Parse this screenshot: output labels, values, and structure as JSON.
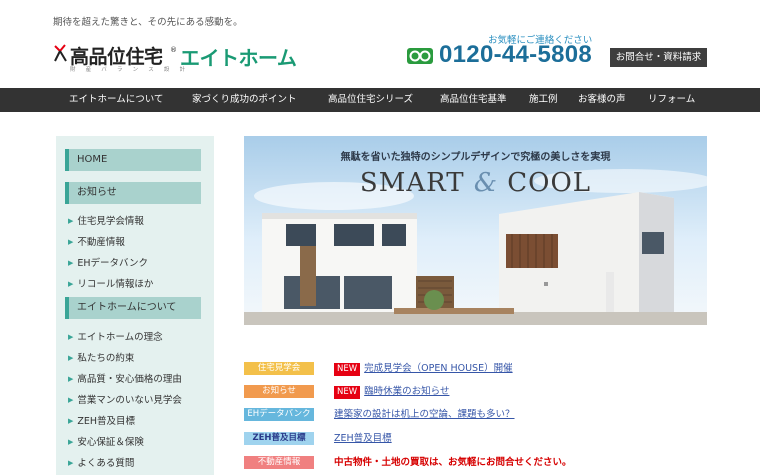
{
  "header": {
    "tagline": "期待を超えた驚きと、その先にある感動を。",
    "logo_main": "高品位住宅",
    "logo_reg": "®",
    "logo_sub": "財 産 バ ラ ン ス 設 計",
    "logo_brand": "エイトホーム",
    "contact_note": "お気軽にご連絡ください",
    "phone": "0120-44-5808",
    "inquiry_button": "お問合せ・資料請求",
    "brand_color": "#1a9a74"
  },
  "nav": {
    "items": [
      {
        "label": "エイトホームについて"
      },
      {
        "label": "家づくり成功のポイント"
      },
      {
        "label": "高品位住宅シリーズ"
      },
      {
        "label": "高品位住宅基準"
      },
      {
        "label": "施工例"
      },
      {
        "label": "お客様の声"
      },
      {
        "label": "リフォーム"
      }
    ]
  },
  "sidebar": {
    "home": "HOME",
    "news_head": "お知らせ",
    "news_links": [
      {
        "label": "住宅見学会情報"
      },
      {
        "label": "不動産情報"
      },
      {
        "label": "EHデータバンク"
      },
      {
        "label": "リコール情報ほか"
      }
    ],
    "about_head": "エイトホームについて",
    "about_links": [
      {
        "label": "エイトホームの理念"
      },
      {
        "label": "私たちの約束"
      },
      {
        "label": "高品質・安心価格の理由"
      },
      {
        "label": "営業マンのいない見学会"
      },
      {
        "label": "ZEH普及目標"
      },
      {
        "label": "安心保証＆保険"
      },
      {
        "label": "よくある質問"
      }
    ],
    "accent_color": "#3aa597"
  },
  "banner": {
    "tagline": "無駄を省いた独特のシンプルデザインで究極の美しさを実現",
    "title_left": "SMART",
    "title_amp": "&",
    "title_right": "COOL"
  },
  "news": {
    "new_badge": "NEW",
    "rows": [
      {
        "label": "住宅見学会",
        "color": "#f3c04a",
        "text": "完成見学会（OPEN HOUSE）開催"
      },
      {
        "label": "お知らせ",
        "color": "#f19a4e",
        "text": "臨時休業のお知らせ"
      },
      {
        "label": "EHデータバンク",
        "color": "#66b7dd",
        "text": "建築家の設計は机上の空論、課題も多い？"
      },
      {
        "label": "ZEH普及目標",
        "color": "#9fd3ee",
        "text": "ZEH普及目標"
      },
      {
        "label": "不動産情報",
        "color": "#f08080",
        "text": "中古物件・土地の買取は、お気軽にお問合せください。"
      }
    ]
  }
}
